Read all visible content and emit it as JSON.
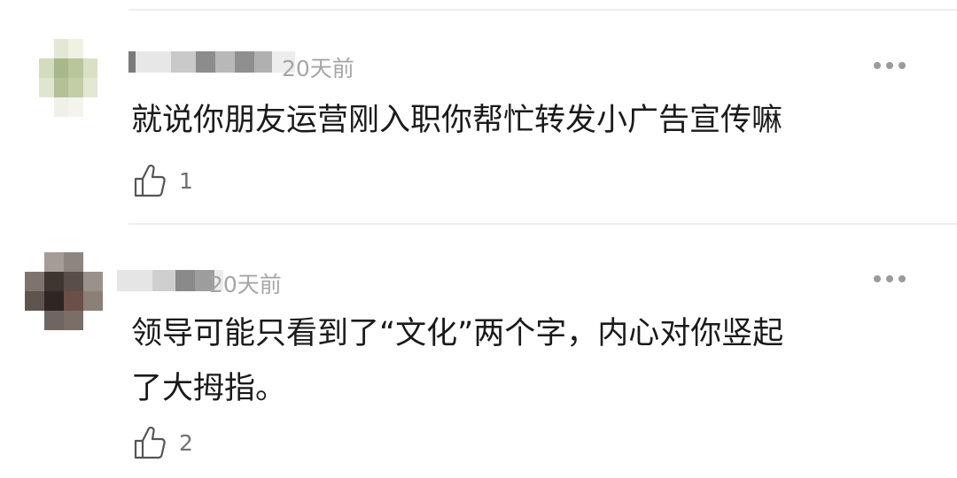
{
  "comments": [
    {
      "time": "20天前",
      "text": "就说你朋友运营刚入职你帮忙转发小广告宣传嘛",
      "likes": "1",
      "avatar_icon": "blurred-avatar-icon",
      "more_icon": "more-icon",
      "like_icon": "thumbs-up-icon"
    },
    {
      "time": "20天前",
      "text_line1": "领导可能只看到了“文化”两个字，内心对你竖起",
      "text_line2": "了大拇指。",
      "likes": "2",
      "avatar_icon": "blurred-avatar-icon",
      "more_icon": "more-icon",
      "like_icon": "thumbs-up-icon"
    }
  ],
  "colors": {
    "background": "#ffffff",
    "text": "#1a1a1a",
    "meta": "#a6a6a6",
    "divider": "#eeeeee"
  }
}
